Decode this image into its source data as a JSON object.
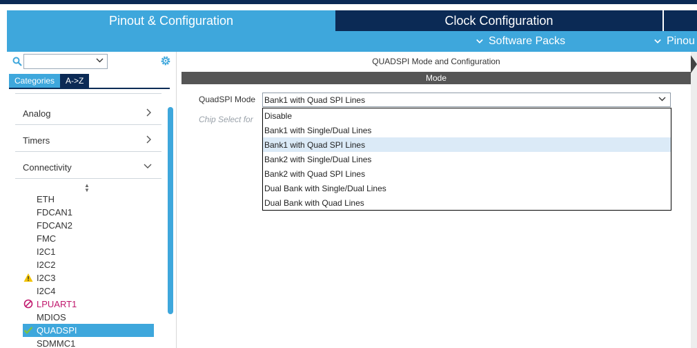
{
  "tabs": {
    "pinout": "Pinout & Configuration",
    "clock": "Clock Configuration"
  },
  "subbar": {
    "software_packs": "Software Packs",
    "pinout": "Pinou"
  },
  "left": {
    "search_value": "",
    "cat_tab_categories": "Categories",
    "cat_tab_az": "A->Z",
    "groups": [
      {
        "label": "Analog",
        "state": "collapsed"
      },
      {
        "label": "Timers",
        "state": "collapsed"
      },
      {
        "label": "Connectivity",
        "state": "expanded"
      }
    ],
    "peripherals": [
      {
        "label": "ETH",
        "status": "none"
      },
      {
        "label": "FDCAN1",
        "status": "none"
      },
      {
        "label": "FDCAN2",
        "status": "none"
      },
      {
        "label": "FMC",
        "status": "none"
      },
      {
        "label": "I2C1",
        "status": "none"
      },
      {
        "label": "I2C2",
        "status": "none"
      },
      {
        "label": "I2C3",
        "status": "warning"
      },
      {
        "label": "I2C4",
        "status": "none"
      },
      {
        "label": "LPUART1",
        "status": "error"
      },
      {
        "label": "MDIOS",
        "status": "none"
      },
      {
        "label": "QUADSPI",
        "status": "ok"
      },
      {
        "label": "SDMMC1",
        "status": "none"
      }
    ]
  },
  "right": {
    "title": "QUADSPI Mode and Configuration",
    "section": "Mode",
    "mode_label": "QuadSPI Mode",
    "mode_value": "Bank1 with Quad SPI Lines",
    "hint": "Chip Select for",
    "options": [
      "Disable",
      "Bank1 with Single/Dual Lines",
      "Bank1 with Quad SPI Lines",
      "Bank2 with Single/Dual Lines",
      "Bank2 with Quad SPI Lines",
      "Dual Bank with Single/Dual Lines",
      "Dual Bank with Quad Lines"
    ],
    "highlighted_option": 2
  },
  "colors": {
    "accent": "#3ea7dc",
    "navy": "#0b2a55",
    "warning": "#f2c300",
    "error": "#c0166c",
    "ok": "#7fc241"
  }
}
